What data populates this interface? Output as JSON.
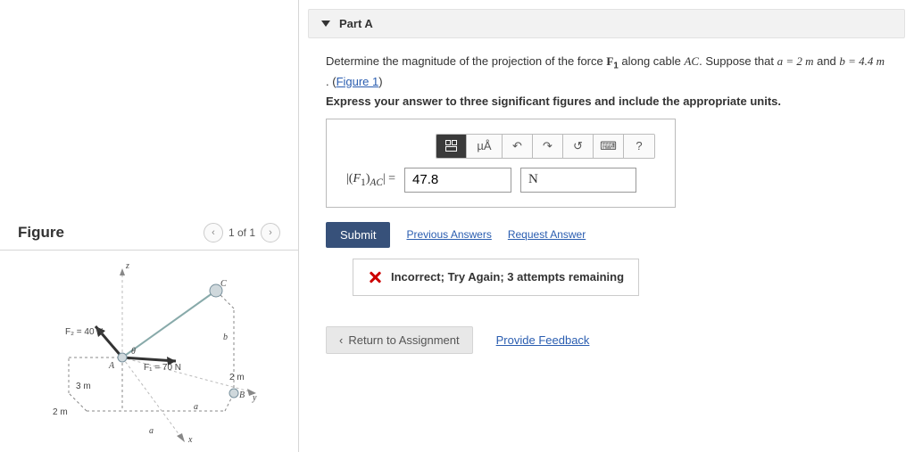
{
  "figure": {
    "title": "Figure",
    "pager": {
      "text": "1 of 1"
    },
    "labels": {
      "z": "z",
      "y": "y",
      "x": "x",
      "C": "C",
      "A": "A",
      "B": "B",
      "a_lbl": "a",
      "b_lbl": "b",
      "F1": "F₁ = 70 N",
      "F2": "F₂ = 40 N",
      "d3m": "3 m",
      "d2m_left": "2 m",
      "d2m_right": "2 m",
      "theta": "θ"
    }
  },
  "part": {
    "header": "Part A",
    "question_prefix": "Determine the magnitude of the projection of the force ",
    "force_sym": "F",
    "force_sub": "1",
    "question_mid": " along cable ",
    "cable": "AC",
    "question_tail": ". Suppose that ",
    "a_eq": "a = 2  m",
    "and": " and ",
    "b_eq": "b = 4.4  m",
    "period": " . (",
    "fig_link": "Figure 1",
    "close_paren": ")",
    "instruction": "Express your answer to three significant figures and include the appropriate units.",
    "toolbar": {
      "units_btn": "µÅ",
      "help_btn": "?"
    },
    "lhs": "|(F₁)AC| =",
    "value": "47.8",
    "unit": "N",
    "submit": "Submit",
    "prev_answers": "Previous Answers",
    "request_answer": "Request Answer",
    "feedback": "Incorrect; Try Again; 3 attempts remaining",
    "return": "Return to Assignment",
    "provide_feedback": "Provide Feedback"
  }
}
